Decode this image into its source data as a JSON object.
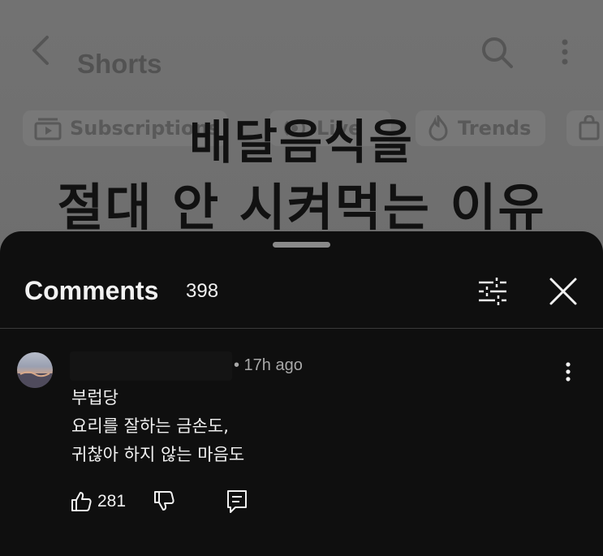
{
  "background": {
    "header": {
      "title": "Shorts"
    },
    "chips": [
      {
        "label": "Subscriptions",
        "icon": "subscriptions-icon"
      },
      {
        "label": "Live",
        "icon": "live-icon"
      },
      {
        "label": "Trends",
        "icon": "trending-flame-icon"
      }
    ],
    "video_overlay": {
      "line1": "배달음식을",
      "line2": "절대 안 시켜먹는 이유"
    }
  },
  "comments_sheet": {
    "title": "Comments",
    "count": "398",
    "comment": {
      "time": "• 17h ago",
      "lines": [
        "부럽당",
        "요리를 잘하는 금손도,",
        "귀찮아 하지 않는 마음도"
      ],
      "like_count": "281"
    }
  },
  "colors": {
    "sheet_bg": "#0f0f0f",
    "text": "#f1f1f1",
    "secondary_text": "#a8a8a8",
    "dim_bg": "#6f6f6f"
  }
}
